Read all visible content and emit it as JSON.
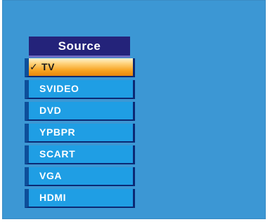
{
  "menu": {
    "title": "Source",
    "check_glyph": "✓",
    "items": [
      {
        "label": "TV",
        "selected": true
      },
      {
        "label": "SVIDEO",
        "selected": false
      },
      {
        "label": "DVD",
        "selected": false
      },
      {
        "label": "YPBPR",
        "selected": false
      },
      {
        "label": "SCART",
        "selected": false
      },
      {
        "label": "VGA",
        "selected": false
      },
      {
        "label": "HDMI",
        "selected": false
      }
    ]
  },
  "colors": {
    "screen_background": "#3c97d4",
    "title_background": "#24237a",
    "item_background": "#1f9ee4",
    "selected_highlight": "#f7a21f"
  }
}
